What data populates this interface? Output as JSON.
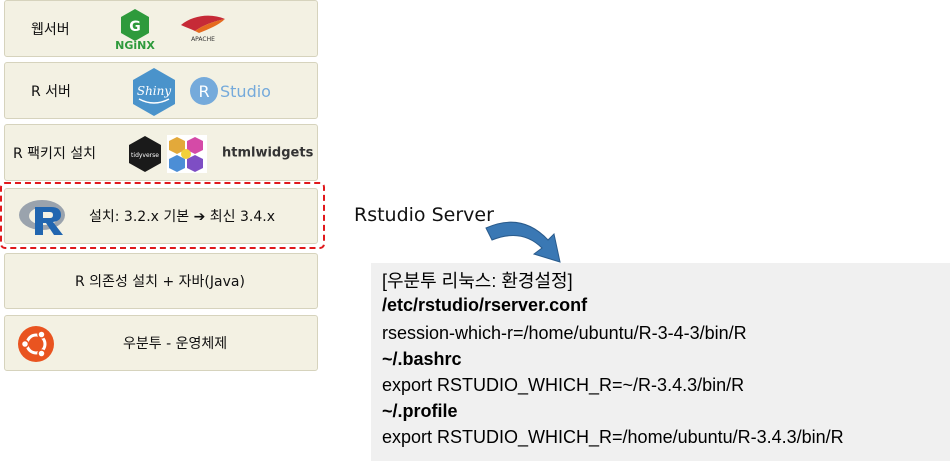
{
  "layers": [
    {
      "label": "웹서버",
      "logos": [
        "nginx-logo",
        "apache-feather-logo"
      ],
      "nginx_text": "NGiNX",
      "apache_text": "APACHE"
    },
    {
      "label": "R 서버",
      "logos": [
        "shiny-logo",
        "rstudio-logo"
      ],
      "shiny_text": "Shiny",
      "rstudio_text": "Studio",
      "rstudio_r": "R"
    },
    {
      "label": "R 팩키지 설치",
      "logos": [
        "tidyverse-hex",
        "hex-sticker-collage"
      ],
      "tidyverse_text": "tidyverse",
      "htmlwidgets_text": "htmlwidgets"
    },
    {
      "label": "설치: 3.2.x 기본 ➔ 최신 3.4.x",
      "logos": [
        "r-logo"
      ],
      "highlighted": true
    },
    {
      "label": "R 의존성 설치 + 자바(Java)",
      "logos": []
    },
    {
      "label": "우분투 - 운영체제",
      "logos": [
        "ubuntu-logo"
      ]
    }
  ],
  "rstudio_server_title": "Rstudio Server",
  "config": {
    "heading": "[우분투 리눅스: 환경설정]",
    "lines": [
      {
        "text": "/etc/rstudio/rserver.conf",
        "bold": true
      },
      {
        "text": "rsession-which-r=/home/ubuntu/R-3-4-3/bin/R",
        "bold": false
      },
      {
        "text": "~/.bashrc",
        "bold": true
      },
      {
        "text": "export RSTUDIO_WHICH_R=~/R-3.4.3/bin/R",
        "bold": false
      },
      {
        "text": "~/.profile",
        "bold": true
      },
      {
        "text": "export RSTUDIO_WHICH_R=/home/ubuntu/R-3.4.3/bin/R",
        "bold": false
      }
    ]
  },
  "colors": {
    "layer_bg": "#f3f1e3",
    "highlight_border": "#e0191c",
    "arrow": "#3a78b4",
    "config_bg": "#f0f0f0"
  }
}
